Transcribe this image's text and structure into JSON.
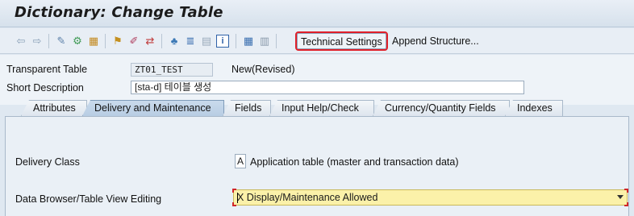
{
  "window": {
    "title": "Dictionary: Change Table"
  },
  "toolbar": {
    "icons": [
      {
        "name": "back-icon",
        "glyph": "⇦",
        "color": "#8aa0b8"
      },
      {
        "name": "forward-icon",
        "glyph": "⇨",
        "color": "#8aa0b8"
      },
      {
        "name": "display-change-icon",
        "glyph": "✎",
        "color": "#5a7fa8"
      },
      {
        "name": "other-object-icon",
        "glyph": "⚙",
        "color": "#3f9a55"
      },
      {
        "name": "check-icon",
        "glyph": "▦",
        "color": "#c48a20"
      },
      {
        "name": "activate-icon",
        "glyph": "⚑",
        "color": "#c49020"
      },
      {
        "name": "where-used-icon",
        "glyph": "✐",
        "color": "#b04060"
      },
      {
        "name": "display-object-list-icon",
        "glyph": "⇄",
        "color": "#c03a3a"
      },
      {
        "name": "hierarchy-icon",
        "glyph": "♣",
        "color": "#3b78b5"
      },
      {
        "name": "list-icon",
        "glyph": "≣",
        "color": "#3b6fb0"
      },
      {
        "name": "table-icon",
        "glyph": "▤",
        "color": "#9aaabb"
      },
      {
        "name": "info-icon",
        "glyph": "i",
        "color": "#2f62a8"
      },
      {
        "name": "grid-icon",
        "glyph": "▦",
        "color": "#3a6fb0"
      },
      {
        "name": "contents-icon",
        "glyph": "▥",
        "color": "#8a9aab"
      }
    ],
    "technical_settings_label": "Technical Settings",
    "append_structure_label": "Append Structure..."
  },
  "header": {
    "table_type_label": "Transparent Table",
    "table_name": "ZT01_TEST",
    "status": "New(Revised)",
    "short_description_label": "Short Description",
    "short_description": "[sta-d] 테이블 생성"
  },
  "tabs": [
    {
      "label": "Attributes",
      "active": false
    },
    {
      "label": "Delivery and Maintenance",
      "active": true
    },
    {
      "label": "Fields",
      "active": false
    },
    {
      "label": "Input Help/Check",
      "active": false
    },
    {
      "label": "Currency/Quantity Fields",
      "active": false
    },
    {
      "label": "Indexes",
      "active": false
    }
  ],
  "content": {
    "delivery_class_label": "Delivery Class",
    "delivery_class_code": "A",
    "delivery_class_text": "Application table (master and transaction data)",
    "data_browser_label": "Data Browser/Table View Editing",
    "data_browser_value": "X Display/Maintenance Allowed"
  },
  "colors": {
    "highlight_outline": "#e0202a",
    "dropdown_bg": "#fbf1a9",
    "active_tab": "#c9daec"
  }
}
